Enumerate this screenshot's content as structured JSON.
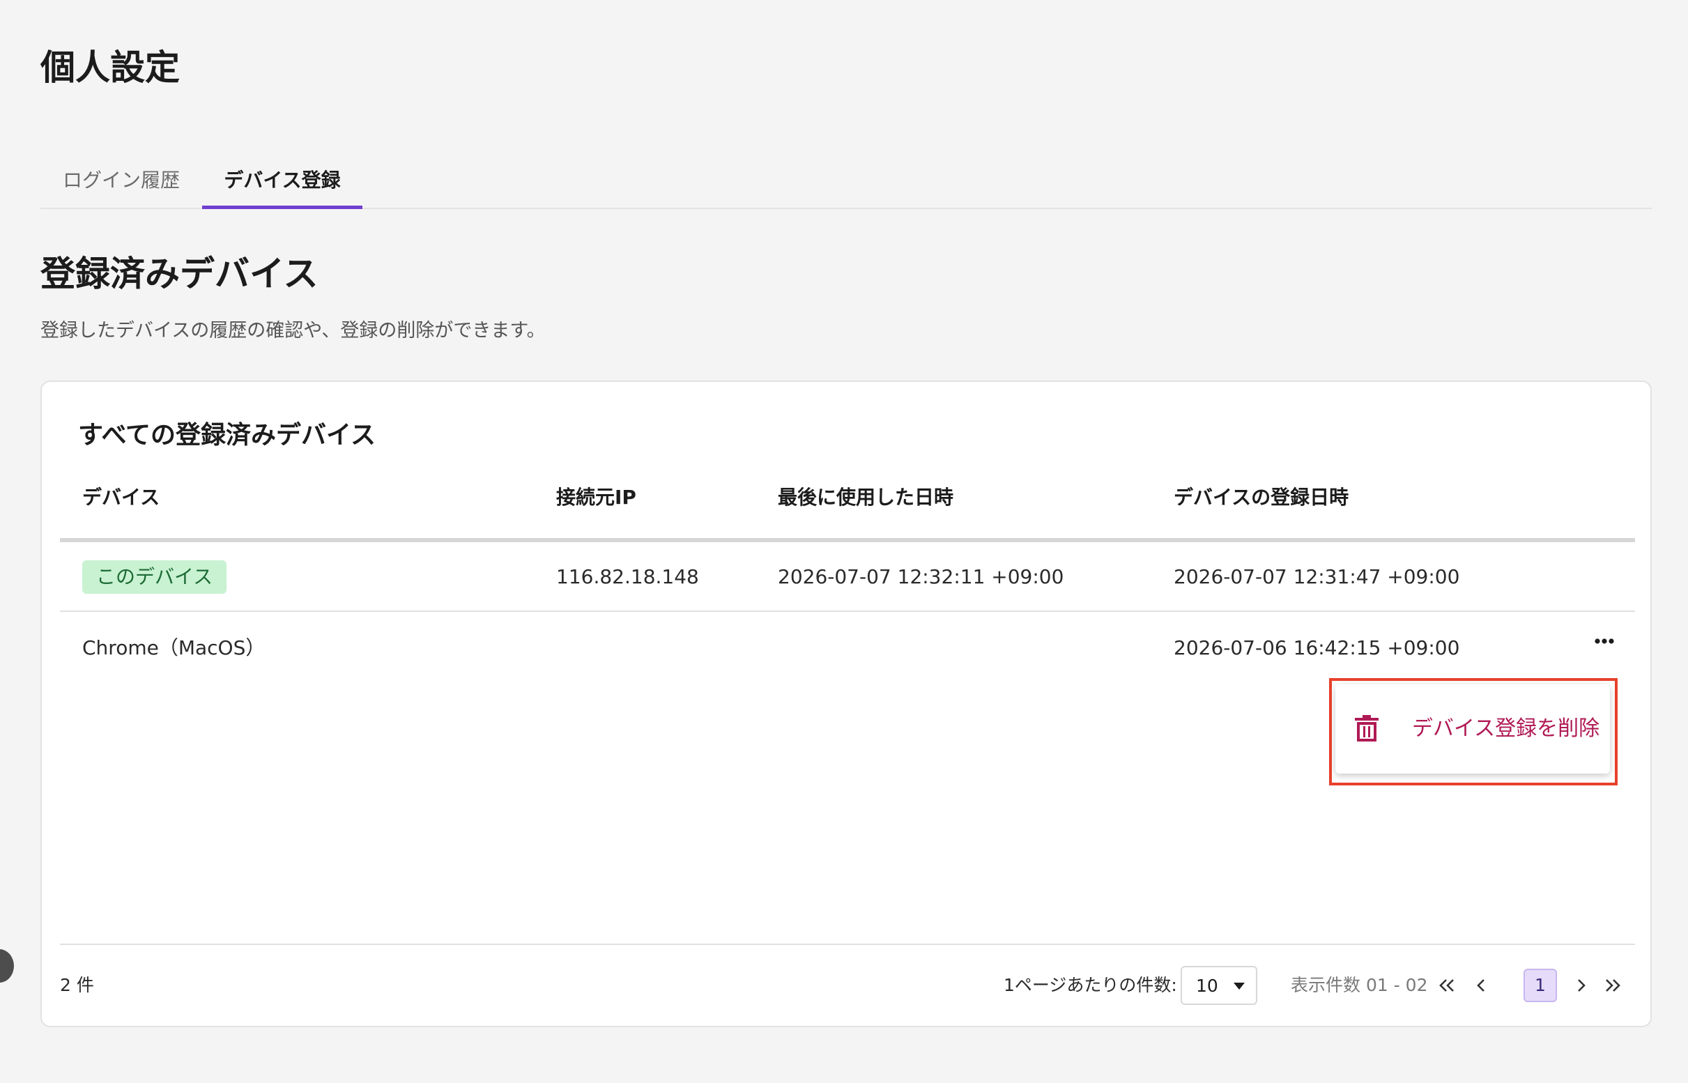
{
  "page": {
    "title": "個人設定"
  },
  "tabs": [
    {
      "label": "ログイン履歴",
      "active": false
    },
    {
      "label": "デバイス登録",
      "active": true
    }
  ],
  "section": {
    "title": "登録済みデバイス",
    "description": "登録したデバイスの履歴の確認や、登録の削除ができます。"
  },
  "card": {
    "title": "すべての登録済みデバイス",
    "columns": [
      "デバイス",
      "接続元IP",
      "最後に使用した日時",
      "デバイスの登録日時"
    ],
    "rows": [
      {
        "device": "このデバイス",
        "device_is_badge": true,
        "ip": "116.82.18.148",
        "last_used": "2026-07-07 12:32:11 +09:00",
        "registered": "2026-07-07 12:31:47 +09:00"
      },
      {
        "device": "Chrome（MacOS）",
        "device_is_badge": false,
        "ip": "",
        "last_used": "",
        "registered": "2026-07-06 16:42:15 +09:00"
      }
    ],
    "row_menu": {
      "icon": "trash-icon",
      "label": "デバイス登録を削除"
    }
  },
  "footer": {
    "total": "2 件",
    "per_page_label": "1ページあたりの件数:",
    "per_page_value": "10",
    "range": "表示件数 01 - 02",
    "current_page": "1"
  },
  "colors": {
    "accent": "#6f3fd0",
    "badge_bg": "#c9f2d2",
    "badge_text": "#1d6b35",
    "danger": "#b01a55",
    "highlight_outline": "#e8412c"
  }
}
